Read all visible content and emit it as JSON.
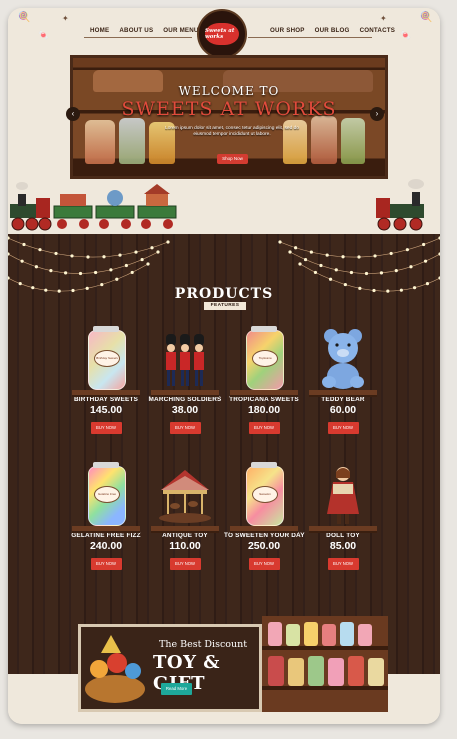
{
  "nav": {
    "left": [
      "HOME",
      "ABOUT US",
      "OUR MENU"
    ],
    "right": [
      "OUR SHOP",
      "OUR BLOG",
      "CONTACTS"
    ]
  },
  "logo": {
    "text": "Sweets at works"
  },
  "slider": {
    "title1": "WELCOME TO",
    "title2": "SWEETS AT WORKS",
    "text": "Lorem ipsum dolor sit amet, consec tetur adipiscing elit, sed do eiusmod tempor incididunt ut labore.",
    "button": "Shop Now",
    "prev_icon": "chevron-left",
    "next_icon": "chevron-right"
  },
  "products": {
    "title": "PRODUCTS",
    "subtitle": "FEATURES",
    "buy_label": "BUY NOW",
    "items": [
      {
        "name": "BIRTHDAY SWEETS",
        "price": "145.00",
        "label": "Birthday Sweets"
      },
      {
        "name": "MARCHING SOLDIERS",
        "price": "38.00"
      },
      {
        "name": "TROPICANA SWEETS",
        "price": "180.00",
        "label": "Tropicana"
      },
      {
        "name": "TEDDY BEAR",
        "price": "60.00"
      },
      {
        "name": "GELATINE FREE FIZZ",
        "price": "240.00",
        "label": "Gelatine Free"
      },
      {
        "name": "ANTIQUE TOY",
        "price": "110.00"
      },
      {
        "name": "TO SWEETEN YOUR DAY",
        "price": "250.00",
        "label": "Sweeten"
      },
      {
        "name": "DOLL TOY",
        "price": "85.00"
      }
    ]
  },
  "banner": {
    "line1": "The Best Discount",
    "line2": "TOY & GIFT",
    "button": "Read More"
  },
  "colors": {
    "accent": "#d83a2f",
    "wood": "#3b2419",
    "cream": "#efe8dc",
    "teal": "#1ea89a"
  }
}
